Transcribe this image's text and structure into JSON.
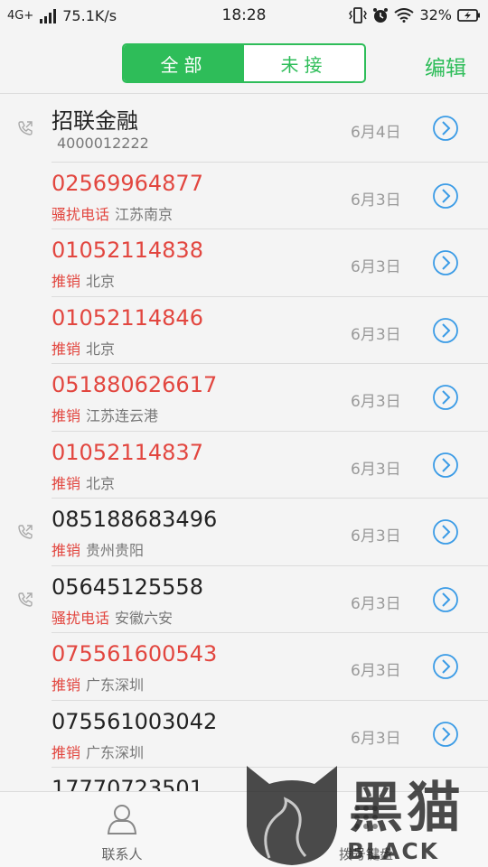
{
  "status_bar": {
    "network": "4G+",
    "speed": "75.1K/s",
    "time": "18:28",
    "battery": "32%"
  },
  "header": {
    "tabs": [
      {
        "label": "全部",
        "active": true
      },
      {
        "label": "未接",
        "active": false
      }
    ],
    "edit_label": "编辑"
  },
  "calls": [
    {
      "name": "招联金融",
      "sub_tag": "",
      "sub_text": "4000012222",
      "date": "6月4日",
      "red": false,
      "outgoing_icon": true
    },
    {
      "name": "02569964877",
      "sub_tag": "骚扰电话",
      "sub_text": "江苏南京",
      "date": "6月3日",
      "red": true,
      "outgoing_icon": false
    },
    {
      "name": "01052114838",
      "sub_tag": "推销",
      "sub_text": "北京",
      "date": "6月3日",
      "red": true,
      "outgoing_icon": false
    },
    {
      "name": "01052114846",
      "sub_tag": "推销",
      "sub_text": "北京",
      "date": "6月3日",
      "red": true,
      "outgoing_icon": false
    },
    {
      "name": "051880626617",
      "sub_tag": "推销",
      "sub_text": "江苏连云港",
      "date": "6月3日",
      "red": true,
      "outgoing_icon": false
    },
    {
      "name": "01052114837",
      "sub_tag": "推销",
      "sub_text": "北京",
      "date": "6月3日",
      "red": true,
      "outgoing_icon": false
    },
    {
      "name": "085188683496",
      "sub_tag": "推销",
      "sub_text": "贵州贵阳",
      "date": "6月3日",
      "red": false,
      "outgoing_icon": true
    },
    {
      "name": "05645125558",
      "sub_tag": "骚扰电话",
      "sub_text": "安徽六安",
      "date": "6月3日",
      "red": false,
      "outgoing_icon": true
    },
    {
      "name": "075561600543",
      "sub_tag": "推销",
      "sub_text": "广东深圳",
      "date": "6月3日",
      "red": true,
      "outgoing_icon": false
    },
    {
      "name": "075561003042",
      "sub_tag": "推销",
      "sub_text": "广东深圳",
      "date": "6月3日",
      "red": false,
      "outgoing_icon": false
    },
    {
      "name": "17770723501",
      "sub_tag": "",
      "sub_text": "",
      "date": "",
      "red": false,
      "outgoing_icon": false
    }
  ],
  "bottom_tabs": [
    {
      "label": "联系人",
      "icon": "person-icon"
    },
    {
      "label": "拨号键盘",
      "icon": "dialpad-icon"
    }
  ],
  "watermark": {
    "text": "黑猫",
    "sub": "BLACK CAT"
  },
  "colors": {
    "accent_green": "#2ebd59",
    "spam_red": "#e2463f",
    "info_blue": "#3a9be6"
  }
}
